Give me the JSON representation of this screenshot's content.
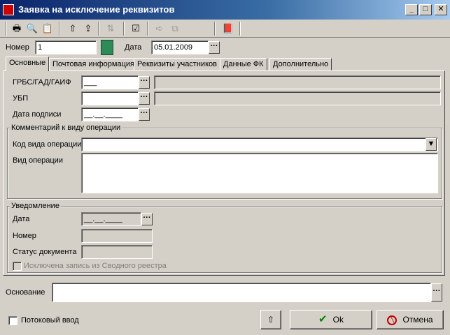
{
  "window": {
    "title": "Заявка на исключение реквизитов",
    "minimize_glyph": "_",
    "maximize_glyph": "□",
    "close_glyph": "✕"
  },
  "toolbar": {
    "icons": [
      "print-icon",
      "preview-icon",
      "print-setup-icon",
      "import-icon",
      "export-icon",
      "refresh-icon",
      "check-icon",
      "forward-icon",
      "copy-icon",
      "book-icon"
    ]
  },
  "header": {
    "number_label": "Номер",
    "number_value": "1",
    "date_label": "Дата",
    "date_value": "05.01.2009"
  },
  "tabs": [
    {
      "label": "Основные",
      "active": true
    },
    {
      "label": "Почтовая информация",
      "active": false
    },
    {
      "label": "Реквизиты участников",
      "active": false
    },
    {
      "label": "Данные ФК",
      "active": false
    },
    {
      "label": "Дополнительно",
      "active": false
    }
  ],
  "main": {
    "grbs_label": "ГРБС/ГАД/ГАИФ",
    "grbs_value": "___",
    "ubp_label": "УБП",
    "ubp_value": "",
    "sign_date_label": "Дата подписи",
    "sign_date_value": "__.__.____",
    "comment_group": {
      "title": "Комментарий к виду операции",
      "op_code_label": "Код вида операции",
      "op_code_value": "",
      "op_type_label": "Вид операции",
      "op_type_value": ""
    },
    "notification_group": {
      "title": "Уведомление",
      "date_label": "Дата",
      "date_value": "__.__.____",
      "number_label": "Номер",
      "number_value": "",
      "status_label": "Статус документа",
      "status_value": "",
      "excluded_label": "Исключена запись из Сводного реестра",
      "excluded_checked": false
    }
  },
  "footer": {
    "basis_label": "Основание",
    "basis_value": "",
    "stream_label": "Потоковый ввод",
    "stream_checked": false,
    "ok_label": "Ok",
    "cancel_label": "Отмена"
  }
}
